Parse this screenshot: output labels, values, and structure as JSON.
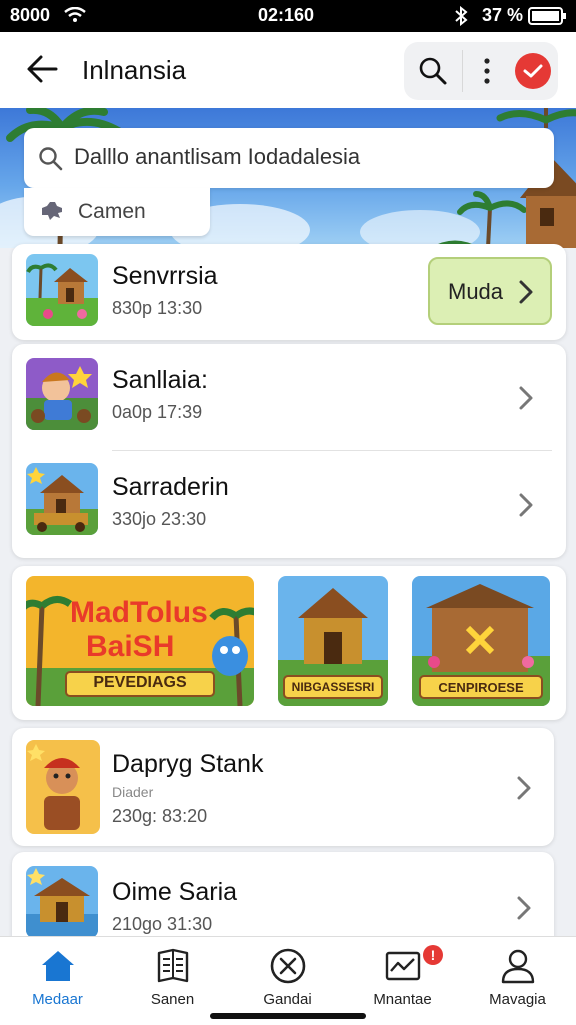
{
  "status": {
    "left": "8000",
    "time": "02:160",
    "battery": "37 %"
  },
  "header": {
    "title": "Inlnansia"
  },
  "search": {
    "placeholder": "Dalllo anantlisam Iodadalesia",
    "camera_label": "Camen"
  },
  "featured": {
    "title": "Senvrrsia",
    "subtitle": "830p 13:30",
    "button_label": "Muda"
  },
  "list1": [
    {
      "title": "Sanllaia:",
      "subtitle": "0a0p 17:39"
    },
    {
      "title": "Sarraderin",
      "subtitle": "330jo 23:30"
    }
  ],
  "gallery": [
    {
      "title_line1": "MadTolus",
      "title_line2": "BaiSH",
      "caption": "PEVEDIAGS"
    },
    {
      "caption": "NIBGASSESRI"
    },
    {
      "caption": "CENPIROESE"
    }
  ],
  "list2": [
    {
      "title": "Dapryg Stank",
      "note": "Diader",
      "subtitle": "230g: 83:20"
    },
    {
      "title": "Oime Saria",
      "subtitle": "210go 31:30"
    }
  ],
  "nav": [
    {
      "label": "Medaar",
      "active": true
    },
    {
      "label": "Sanen"
    },
    {
      "label": "Gandai"
    },
    {
      "label": "Mnantae",
      "badge": "!"
    },
    {
      "label": "Mavagia"
    }
  ],
  "colors": {
    "accent": "#1976d2",
    "badge": "#e53935",
    "button_bg": "#dcefb4",
    "button_border": "#b4cf7a"
  }
}
